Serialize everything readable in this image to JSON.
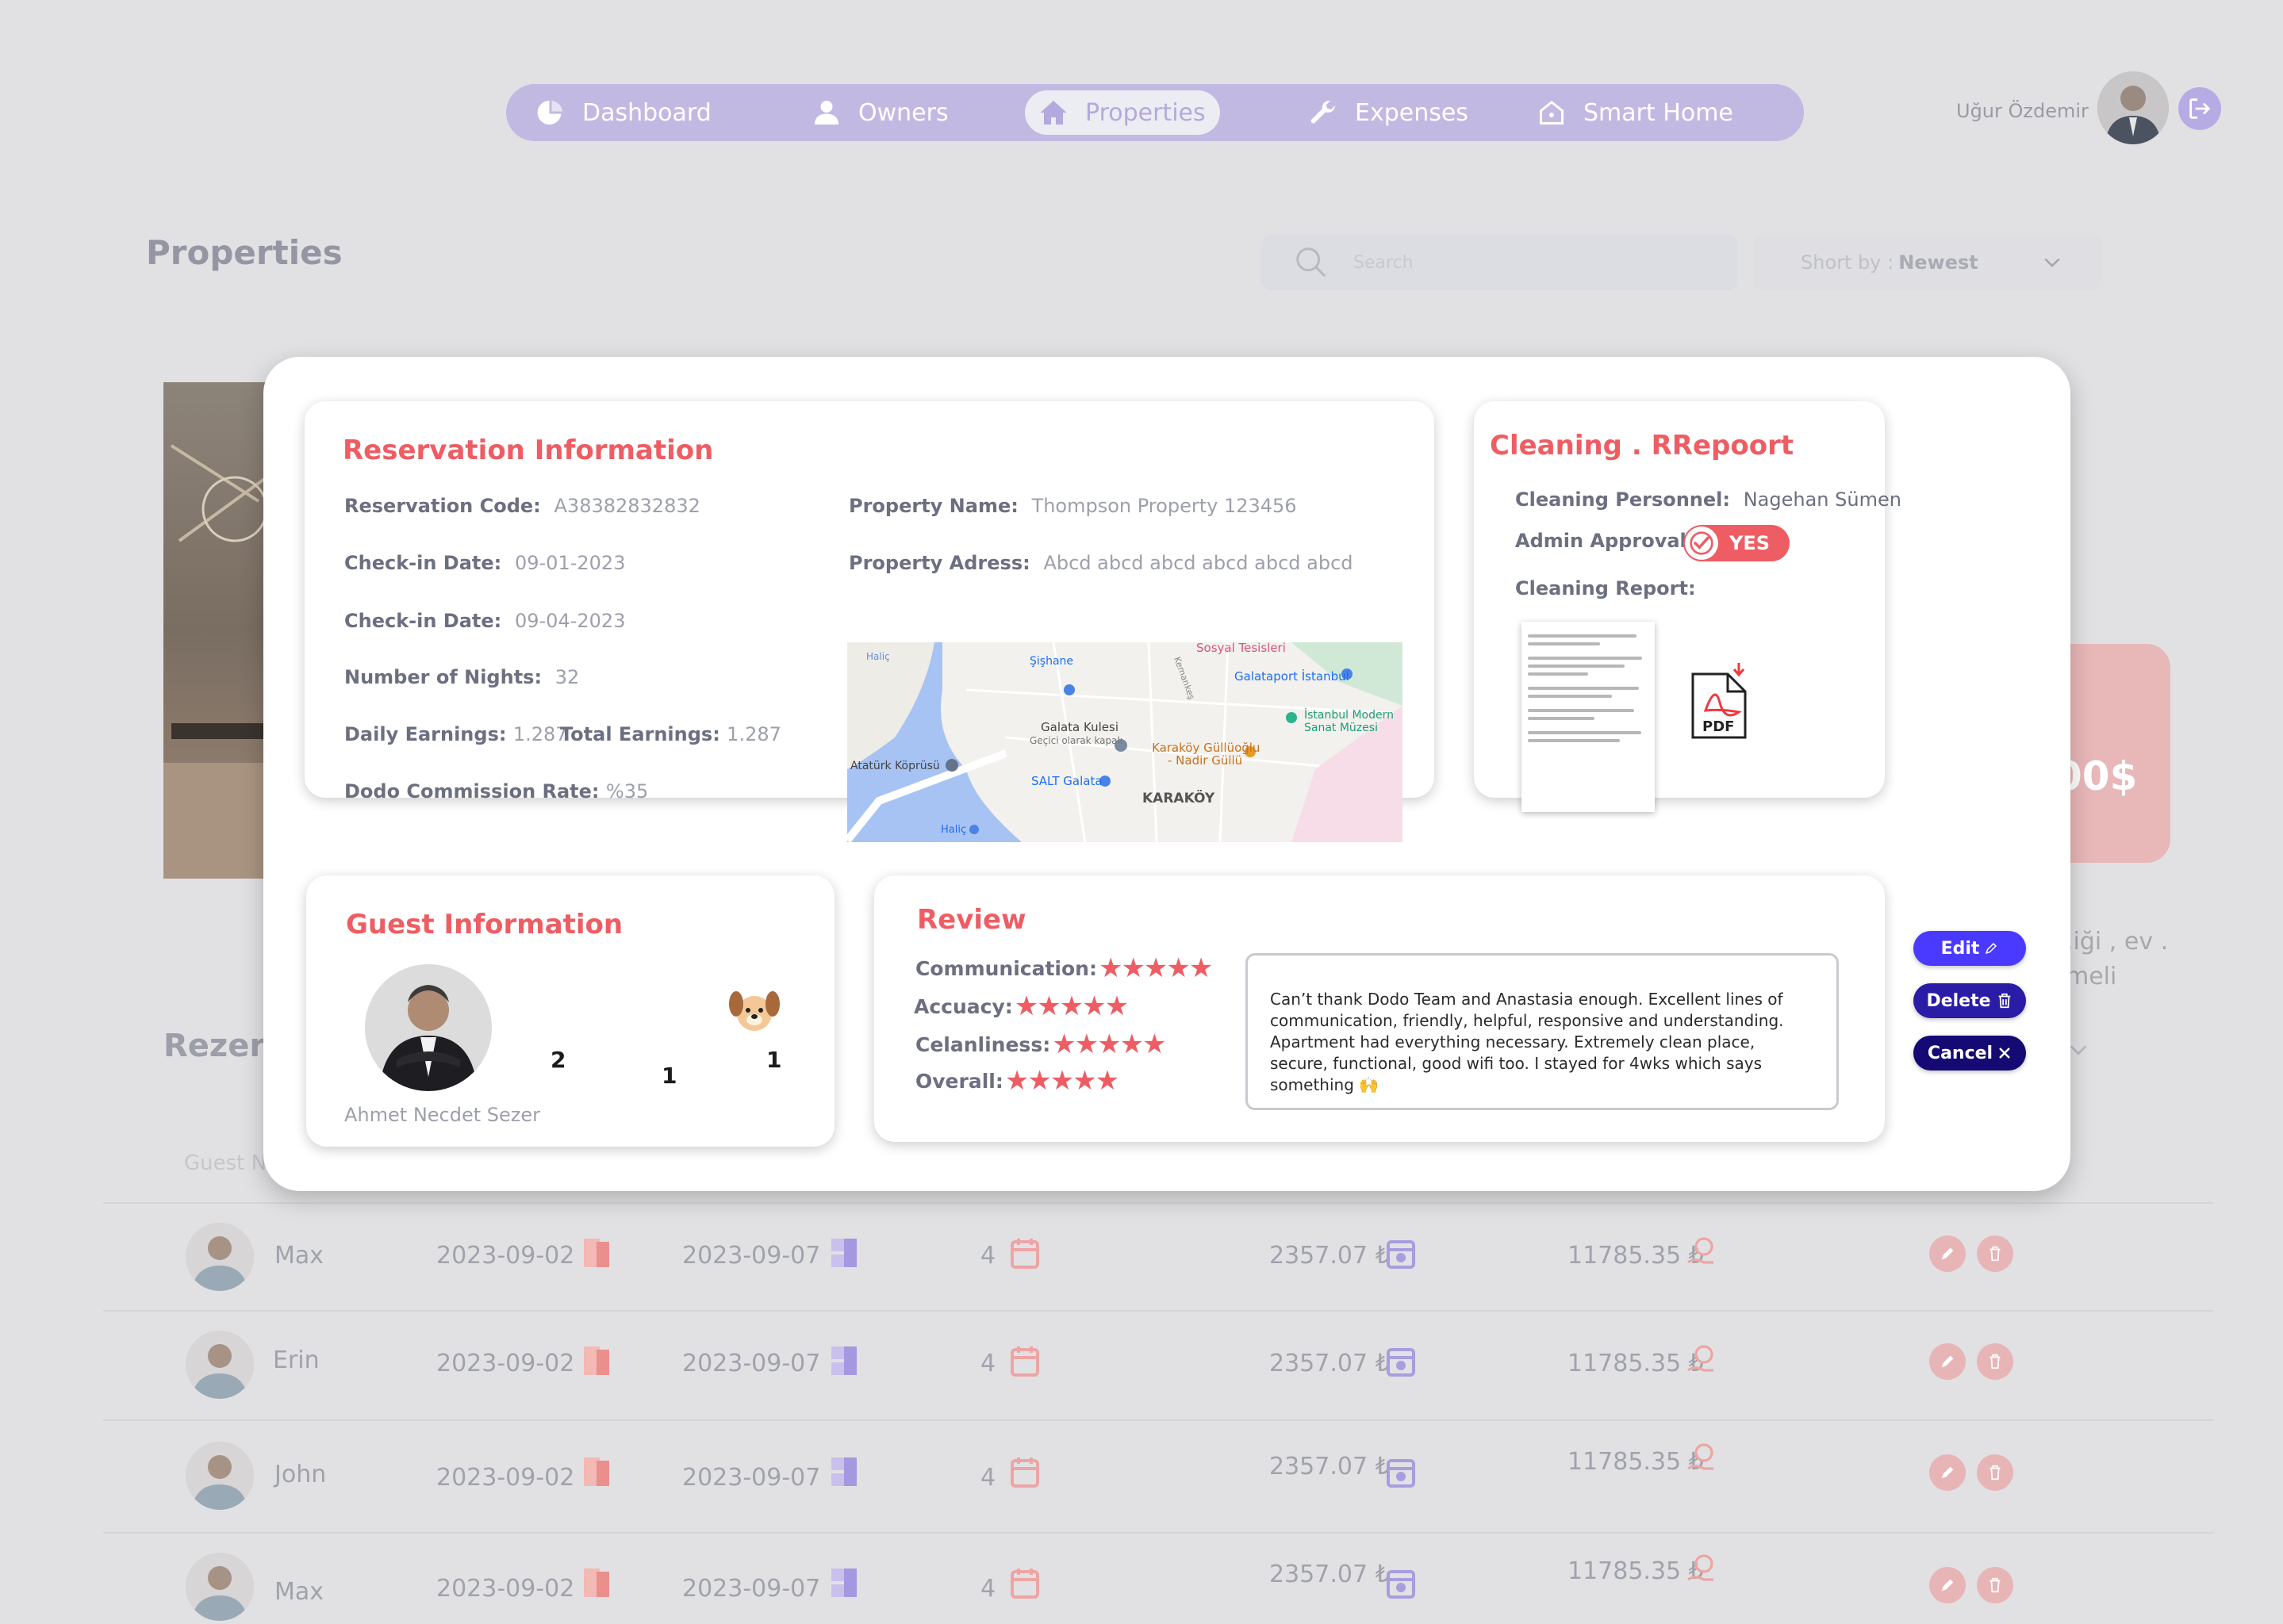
{
  "nav": {
    "items": [
      {
        "label": "Dashboard",
        "icon": "pie-chart-icon"
      },
      {
        "label": "Owners",
        "icon": "person-icon"
      },
      {
        "label": "Properties",
        "icon": "home-icon",
        "active": true
      },
      {
        "label": "Expenses",
        "icon": "wrench-icon"
      },
      {
        "label": "Smart Home",
        "icon": "smart-home-icon"
      }
    ]
  },
  "user": {
    "name": "Uğur Özdemir"
  },
  "page": {
    "title": "Properties",
    "search_placeholder": "Search",
    "sort_label": "Short by :",
    "sort_value": "Newest",
    "partial_amount": "00$",
    "partial_text_1": ",iği , ev .",
    "partial_text_2": "meli",
    "rez_title": "Rezerv",
    "guest_col": "Guest N"
  },
  "reservations": [
    {
      "name": "Max",
      "checkin": "2023-09-02",
      "checkout": "2023-09-07",
      "nights": "4",
      "daily": "2357.07 ₺",
      "total": "11785.35 ₺"
    },
    {
      "name": "Erin",
      "checkin": "2023-09-02",
      "checkout": "2023-09-07",
      "nights": "4",
      "daily": "2357.07 ₺",
      "total": "11785.35 ₺"
    },
    {
      "name": "John",
      "checkin": "2023-09-02",
      "checkout": "2023-09-07",
      "nights": "4",
      "daily": "2357.07 ₺",
      "total": "11785.35 ₺"
    },
    {
      "name": "Max",
      "checkin": "2023-09-02",
      "checkout": "2023-09-07",
      "nights": "4",
      "daily": "2357.07 ₺",
      "total": "11785.35 ₺"
    }
  ],
  "modal": {
    "reservation": {
      "title": "Reservation  Information",
      "code_label": "Reservation Code:",
      "code": "A38382832832",
      "checkin_label": "Check-in Date:",
      "checkin": "09-01-2023",
      "checkout_label": "Check-in Date:",
      "checkout": "09-04-2023",
      "nights_label": "Number of Nights:",
      "nights": "32",
      "daily_label": "Daily Earnings:",
      "daily": "1.287",
      "total_label": "Total Earnings:",
      "total": "1.287",
      "commission_label": "Dodo Commission Rate:",
      "commission": "%35",
      "property_name_label": "Property Name:",
      "property_name": "Thompson Property 123456",
      "property_address_label": "Property Adress:",
      "property_address": "Abcd abcd abcd abcd abcd abcd",
      "map_labels": {
        "sosyal": "Sosyal Tesisleri",
        "galataport": "Galataport İstanbul",
        "sishane": "Şişhane",
        "istanbul_modern_1": "İstanbul Modern",
        "istanbul_modern_2": "Sanat Müzesi",
        "galata_kulesi": "Galata Kulesi",
        "galata_sub": "Geçici olarak kapalı",
        "karakoy_gulluoglu_1": "Karaköy Güllüoğlu",
        "karakoy_gulluoglu_2": "- Nadir Güllü",
        "ataturk": "Atatürk Köprüsü",
        "salt": "SALT Galata",
        "karakoy": "KARAKÖY",
        "halic": "Haliç",
        "halic2": "Haliç",
        "street": "Kemankeş"
      }
    },
    "cleaning": {
      "title": "Cleaning . RRepoort",
      "personnel_label": "Cleaning Personnel:",
      "personnel": "Nagehan Sümen",
      "approval_label": "Admin Approval:",
      "approval": "YES",
      "report_label": "Cleaning Report:",
      "pdf_label": "PDF"
    },
    "guest": {
      "title": "Guest  Information",
      "adults": "2",
      "children": "1",
      "pets": "1",
      "name": "Ahmet Necdet Sezer"
    },
    "review": {
      "title": "Review",
      "communication_label": "Communication:",
      "communication_rating": 5,
      "accuracy_label": "Accuacy:",
      "accuracy_rating": 5,
      "cleanliness_label": "Celanliness:",
      "cleanliness_rating": 5,
      "overall_label": "Overall:",
      "overall_rating": 5,
      "stars": "★★★★★",
      "comment": "Can’t thank Dodo Team and Anastasia enough. Excellent lines of communication, friendly, helpful, responsive and understanding. Apartment had everything necessary. Extremely clean place, secure, functional, good wifi too. I stayed for 4wks which says something 🙌"
    },
    "actions": {
      "edit": "Edit",
      "delete": "Delete",
      "cancel": "Cancel"
    }
  },
  "colors": {
    "accent": "#ee5d63",
    "nav": "#c2b9e3",
    "edit": "#4a3aff",
    "delete": "#2a1ca6",
    "cancel": "#150a73"
  }
}
